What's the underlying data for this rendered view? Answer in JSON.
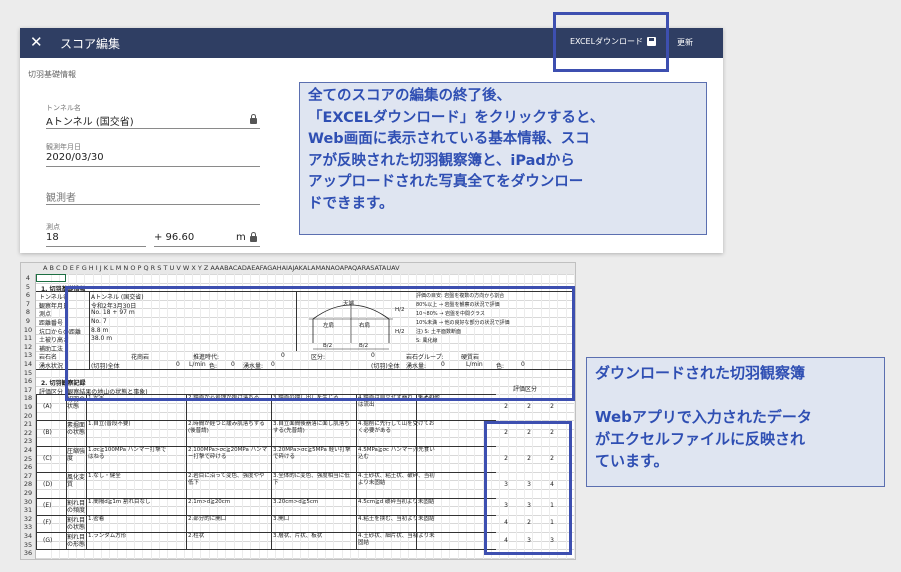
{
  "app": {
    "close_icon": "close-icon",
    "title": "スコア編集",
    "download_label": "EXCELダウンロード",
    "download_icon": "save-icon",
    "update_label": "更新",
    "header_color": "#2f3e63",
    "section_label": "切羽基礎情報",
    "fields": {
      "tunnel": {
        "label": "トンネル名",
        "value": "Aトンネル (国交省)"
      },
      "date": {
        "label": "観測年月日",
        "value": "2020/03/30"
      },
      "observer": {
        "placeholder": "観測者"
      },
      "station": {
        "label": "測点",
        "value_main": "18",
        "value_plus": "+ 96.60",
        "unit": "m"
      }
    }
  },
  "callout1": {
    "lines": [
      "全てのスコアの編集の終了後、",
      "「EXCELダウンロード」をクリックすると、",
      "Web画面に表示されている基本情報、スコ",
      "アが反映された切羽観察簿と、iPadから",
      "アップロードされた写真全てをダウンロー",
      "ドできます。"
    ]
  },
  "callout2": {
    "line1": "ダウンロードされた切羽観察簿",
    "lines": [
      "Webアプリで入力されたデータ",
      "がエクセルファイルに反映され",
      "ています。"
    ]
  },
  "sheet": {
    "col_headers": "A    B    C  D  E  F  G  H  I  J  K  L  M  N  O  P  Q  R  S  T  U  V  W  X  Y  Z AAABACADAEAFAGAHAIAJAKALAMANAOAPAQARASATAUAV",
    "row_numbers": [
      "4",
      "5",
      "6",
      "7",
      "8",
      "9",
      "10",
      "11",
      "12",
      "13",
      "14",
      "15",
      "16",
      "17",
      "18",
      "19",
      "20",
      "21",
      "22",
      "23",
      "24",
      "25",
      "26",
      "27",
      "28",
      "29",
      "30",
      "31",
      "32",
      "33",
      "34",
      "35",
      "36"
    ],
    "section1": "1. 切羽基礎情報",
    "rows1": [
      {
        "label": "トンネル名",
        "value": "Aトンネル (国交省)"
      },
      {
        "label": "観察年月日",
        "value": "令和2年3月30日"
      },
      {
        "label": "測点",
        "value": "No.   18  +  97 m"
      },
      {
        "label": "距離番号",
        "value": "No. 7"
      },
      {
        "label": "坑口からの距離",
        "value": "8.8  m"
      },
      {
        "label": "土被り高さ",
        "value": "38.0  m"
      },
      {
        "label": "補助工法",
        "value": ""
      },
      {
        "label": "岩石名",
        "value": "花崗岩"
      },
      {
        "label": "湧水状況",
        "value": "(切羽)全体"
      }
    ],
    "row13_extra": [
      "推進時代:",
      "0",
      "区分:",
      "0",
      "岩石グループ:",
      "硬質岩"
    ],
    "row14_extra": [
      "0",
      "L/min",
      "色:",
      "0",
      "湧水量:",
      "0",
      "(切羽)全体",
      "湧水量:",
      "0",
      "L/min",
      "色:",
      "0"
    ],
    "diagram": {
      "top": "天端",
      "left": "左肩",
      "right": "右肩",
      "h1": "H/2",
      "h2": "H/2",
      "b1": "B/2",
      "b2": "B/2"
    },
    "notes": [
      "評価の目安: 岩盤を複数の方向から割合",
      "80%以上 → 岩盤を観察の状況で評価",
      "10~80% → 岩盤を中間クラス",
      "10%未満 → 他の良好な部分の状況で評価",
      "注)  S: 土平面数断面",
      "S: 風化線"
    ],
    "section2": "2. 切羽観察記録",
    "eval_label": "評価区分 (観察結果の地山の状態と事象)",
    "eval_header": "評価区分",
    "eval_rows": [
      {
        "rows": [
          "19",
          "20",
          "21"
        ],
        "id": "(A)",
        "name": "切羽の状態",
        "c1": "1.安定",
        "c2": "2.鏡面から岩塊が抜け落ちる",
        "c3": "3.鏡面の押し出しを生じる",
        "c4": "4.鏡面は自立せず崩れ、あるいは流出",
        "c5": "5.その他",
        "scores": [
          "2",
          "2",
          "2"
        ]
      },
      {
        "rows": [
          "22",
          "23",
          "24"
        ],
        "id": "(B)",
        "name": "素掘面の状態",
        "c1": "1.自立(普段不要)",
        "c2": "2.時間が経つと緩み肌落ちする(後普請)",
        "c3": "3.自立面間後崩落に面し肌落ちする(先普請)",
        "c4": "4.掘削に先行して山を受けておく必要がある",
        "c5": "",
        "scores": [
          "2",
          "2",
          "2"
        ]
      },
      {
        "rows": [
          "25",
          "26",
          "27"
        ],
        "id": "(C)",
        "name": "圧縮強度",
        "c1": "1.σc≧100MPa ハンマー打撃ではねる",
        "c2": "2.100MPa>σc≧20MPa ハンマー打撃で砕ける",
        "c3": "3.20MPa>σc≧5MPa 軽い打撃で砕ける",
        "c4": "4.5MPa≧σc ハンマー刃先食い込む",
        "c5": "",
        "scores": [
          "2",
          "2",
          "2"
        ]
      },
      {
        "rows": [
          "28",
          "29",
          "30"
        ],
        "id": "(D)",
        "name": "風化変質",
        "c1": "1.なし・健全",
        "c2": "2.岩目に沿って変色、強度やや低下",
        "c3": "3.全体的に変色、強度相当に低下",
        "c4": "4.土砂状、粘土状、破砕、当初より未固結",
        "c5": "",
        "scores": [
          "3",
          "3",
          "4"
        ]
      },
      {
        "rows": [
          "31",
          "32"
        ],
        "id": "(E)",
        "name": "割れ目の頻度",
        "c1": "1.間隔d≧1m 割れ目なし",
        "c2": "2.1m>d≧20cm",
        "c3": "3.20cm>d≧5cm",
        "c4": "4.5cm≧d 破砕当初より未固結",
        "c5": "",
        "scores": [
          "3",
          "3",
          "1"
        ]
      },
      {
        "rows": [
          "33",
          "34"
        ],
        "id": "(F)",
        "name": "割れ目の状態",
        "c1": "1.密着",
        "c2": "2.部分的に開口",
        "c3": "3.開口",
        "c4": "4.粘土を挟む、当初より未固結",
        "c5": "",
        "scores": [
          "4",
          "2",
          "1"
        ]
      },
      {
        "rows": [
          "35",
          "36"
        ],
        "id": "(G)",
        "name": "割れ目の形態",
        "c1": "1.ランダム方形",
        "c2": "2.柱状",
        "c3": "3.層状、片状、板状",
        "c4": "4.土砂状、細片状、当初より未固結",
        "c5": "",
        "scores": [
          "4",
          "3",
          "3"
        ]
      }
    ]
  }
}
